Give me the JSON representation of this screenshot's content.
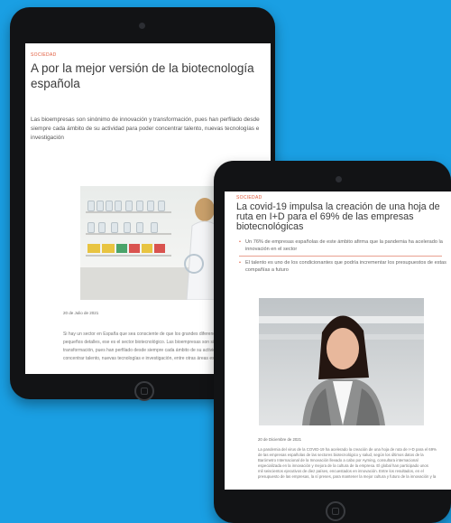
{
  "background_color": "#1a9fe3",
  "accent_color": "#e05a3b",
  "back_tablet": {
    "section": "SOCIEDAD",
    "title": "A por la mejor versión de la biotecnología española",
    "lead": "Las bioempresas son sinónimo de innovación y transformación, pues han perfilado desde siempre cada ámbito de su actividad para poder concentrar talento, nuevas tecnologías e investigación",
    "date": "20 de Julio de 2021",
    "body": [
      "Si hay un sector en España que sea consciente de que los grandes diferencias que marcan",
      "pequeños detalles, ese es el sector biotecnológico. Las bioempresas son sinónimo de innova",
      "transformación, pues han perfilado desde siempre cada ámbito de su actividad para poder",
      "concentrar talento, nuevas tecnologías e investigación, entre otras áreas estratégicas que les"
    ]
  },
  "front_tablet": {
    "section": "SOCIEDAD",
    "title": "La covid-19 impulsa la creación de una hoja de ruta en I+D para el 69% de las empresas biotecnológicas",
    "bullets": [
      "Un 76% de empresas españolas de este ámbito afirma que la pandemia ha acelerado la innovación en el sector",
      "El talento es uno de los condicionantes que podría incrementar los presupuestos de estas compañías a futuro"
    ],
    "date": "20 de Diciembre de 2021",
    "body": [
      "La pandemia del virus de la COVID-19 ha acelerado la creación de una hoja de ruta de I+D para el 69%",
      "de las empresas españolas de las sectores biotecnológico y salud, según los últimos datos de la",
      "Barómetro Internacional de la Innovación llevado a cabo por Ayming, consultora internacional",
      "especializada en la innovación y mejora de la cultura de la empresa. El global han participado unos",
      "mil seiscientos ejecutivos de diez países, encuestados en innovación. Entre los resultados, en el",
      "presupuesto de las empresas, la sí preses, para mantener la mejor cultura y futuro de la innovación y la"
    ]
  }
}
